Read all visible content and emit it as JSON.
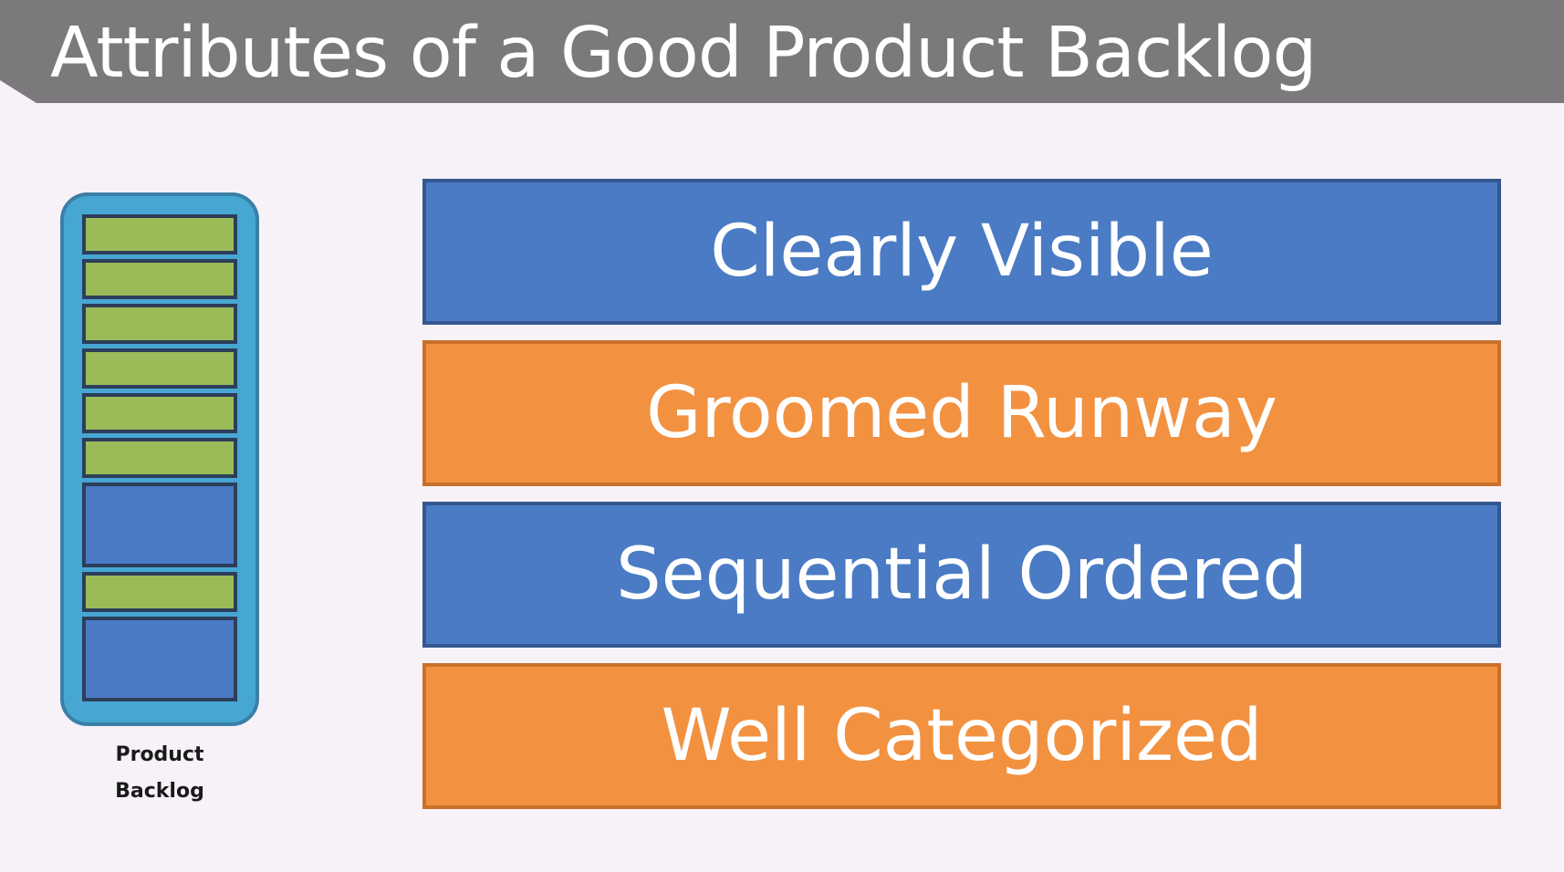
{
  "title": "Attributes of a Good Product Backlog",
  "backlog": {
    "label_line1": "Product",
    "label_line2": "Backlog",
    "items": [
      "green",
      "green",
      "green",
      "green",
      "green",
      "green",
      "blue",
      "green",
      "blue"
    ]
  },
  "attributes": [
    {
      "label": "Clearly Visible",
      "color": "blue"
    },
    {
      "label": "Groomed Runway",
      "color": "orange"
    },
    {
      "label": "Sequential Ordered",
      "color": "blue"
    },
    {
      "label": "Well Categorized",
      "color": "orange"
    }
  ],
  "colors": {
    "blue": "#4a7bc4",
    "orange": "#f29241",
    "green": "#9bbb59",
    "container": "#46a7d3",
    "title_bar": "#7b797c"
  }
}
